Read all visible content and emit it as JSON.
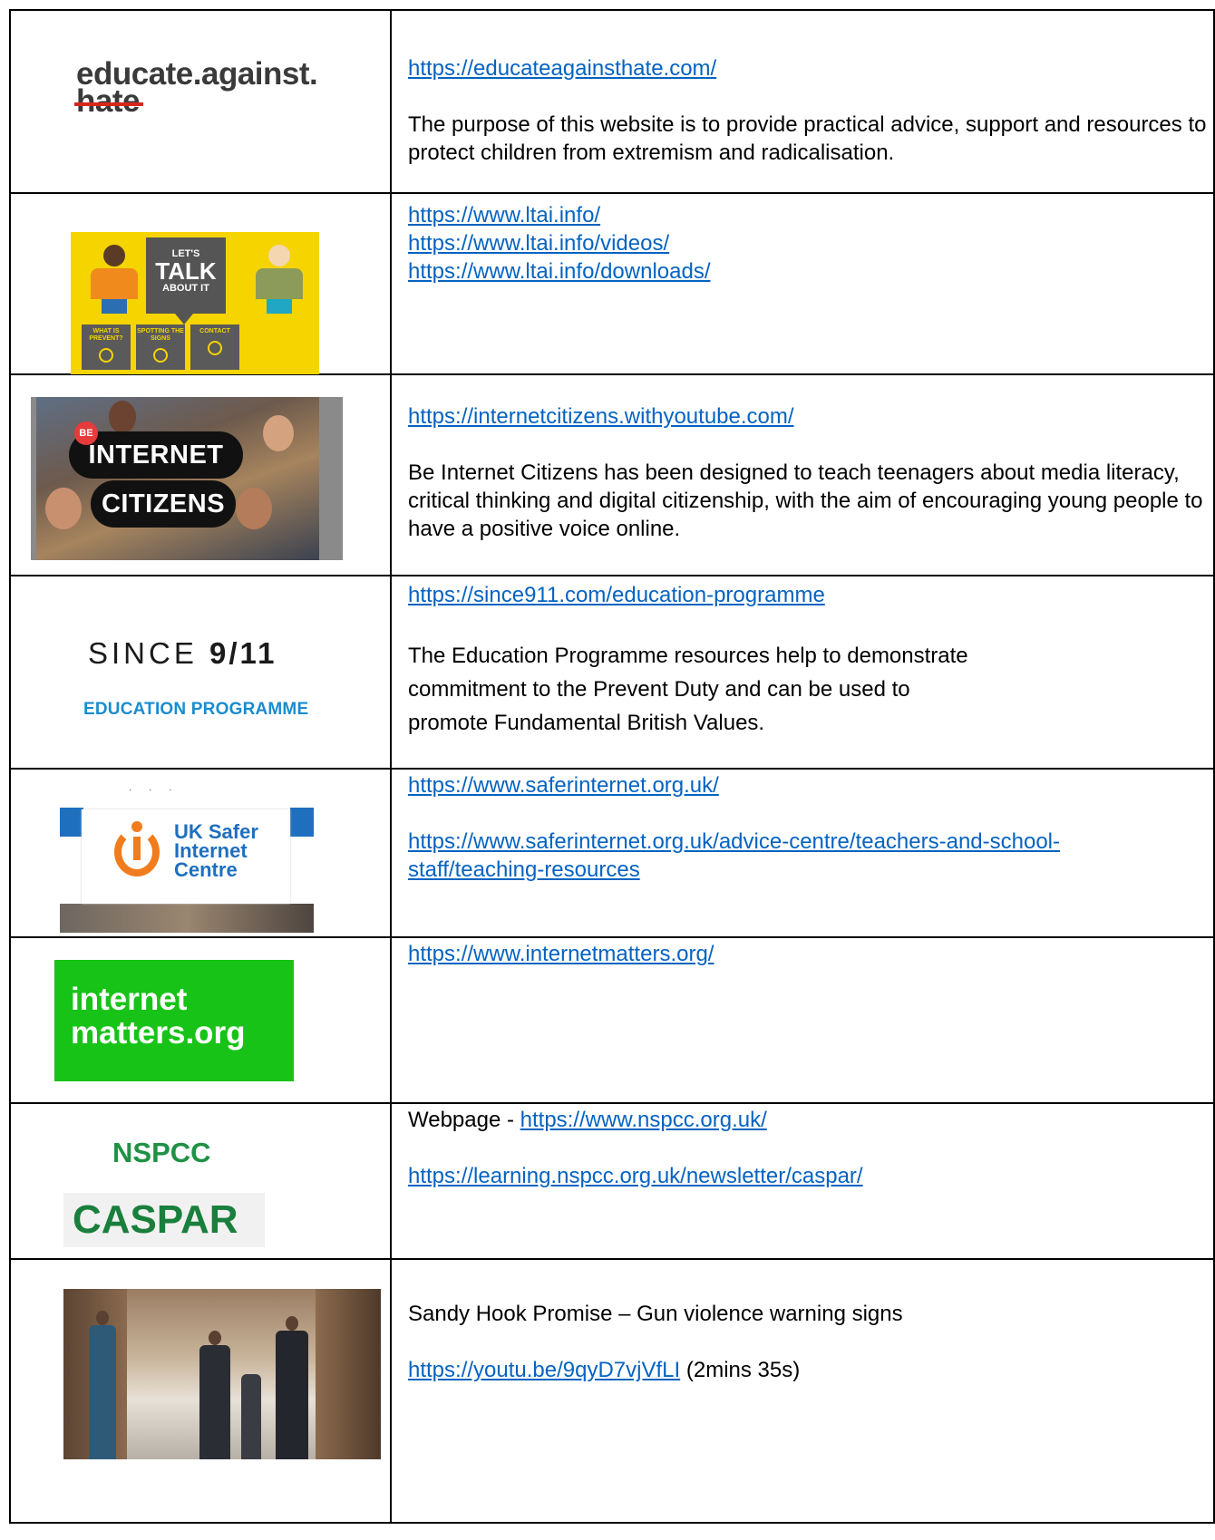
{
  "rows": [
    {
      "logo": {
        "line1": "educate.against.",
        "line2": "hate"
      },
      "links": [
        "https://educateagainsthate.com/"
      ],
      "desc": "The purpose of this website is to provide practical advice, support and resources to protect children from extremism and radicalisation."
    },
    {
      "logo": {
        "bubble_top": "LET'S",
        "bubble_mid": "TALK",
        "bubble_bot": "ABOUT IT",
        "tiles": [
          "WHAT IS PREVENT?",
          "SPOTTING THE SIGNS",
          "CONTACT"
        ]
      },
      "links": [
        "https://www.ltai.info/",
        "https://www.ltai.info/videos/",
        "https://www.ltai.info/downloads/"
      ]
    },
    {
      "logo": {
        "badge": "BE",
        "line1": "INTERNET",
        "line2": "CITIZENS"
      },
      "links": [
        "https://internetcitizens.withyoutube.com/"
      ],
      "desc": "Be Internet Citizens has been designed to teach teenagers about media literacy, critical thinking and digital citizenship, with the aim of encouraging young people to have a positive voice online."
    },
    {
      "logo": {
        "line1a": "SINCE ",
        "line1b": "9/11",
        "line2": "EDUCATION PROGRAMME"
      },
      "links": [
        "https://since911.com/education-programme"
      ],
      "desc_lines": [
        "The Education Programme resources help to demonstrate",
        "commitment to the Prevent Duty and can be used to",
        "promote Fundamental British Values."
      ]
    },
    {
      "logo": {
        "l1": "UK Safer",
        "l2": "Internet",
        "l3": "Centre"
      },
      "links": [
        "https://www.saferinternet.org.uk/",
        "https://www.saferinternet.org.uk/advice-centre/teachers-and-school-",
        "staff/teaching-resources"
      ]
    },
    {
      "logo": {
        "l1": "internet",
        "l2": "matters.org"
      },
      "links": [
        "https://www.internetmatters.org/"
      ]
    },
    {
      "logo": {
        "l1": "NSPCC",
        "l2": "CASPAR"
      },
      "prefix": "Webpage - ",
      "links": [
        "https://www.nspcc.org.uk/",
        "https://learning.nspcc.org.uk/newsletter/caspar/"
      ]
    },
    {
      "title": "Sandy Hook Promise – Gun violence warning signs",
      "links": [
        "https://youtu.be/9qyD7vjVfLI"
      ],
      "suffix": " (2mins 35s)"
    }
  ],
  "colors": {
    "link": "#0563c1",
    "nspcc_green": "#1f9145",
    "im_green": "#17c317",
    "safer_orange": "#f07c1e",
    "safer_blue": "#1f6fbf",
    "since_blue": "#1a8ccf",
    "eah_red": "#d9261c",
    "ltai_yellow": "#f5d400"
  }
}
